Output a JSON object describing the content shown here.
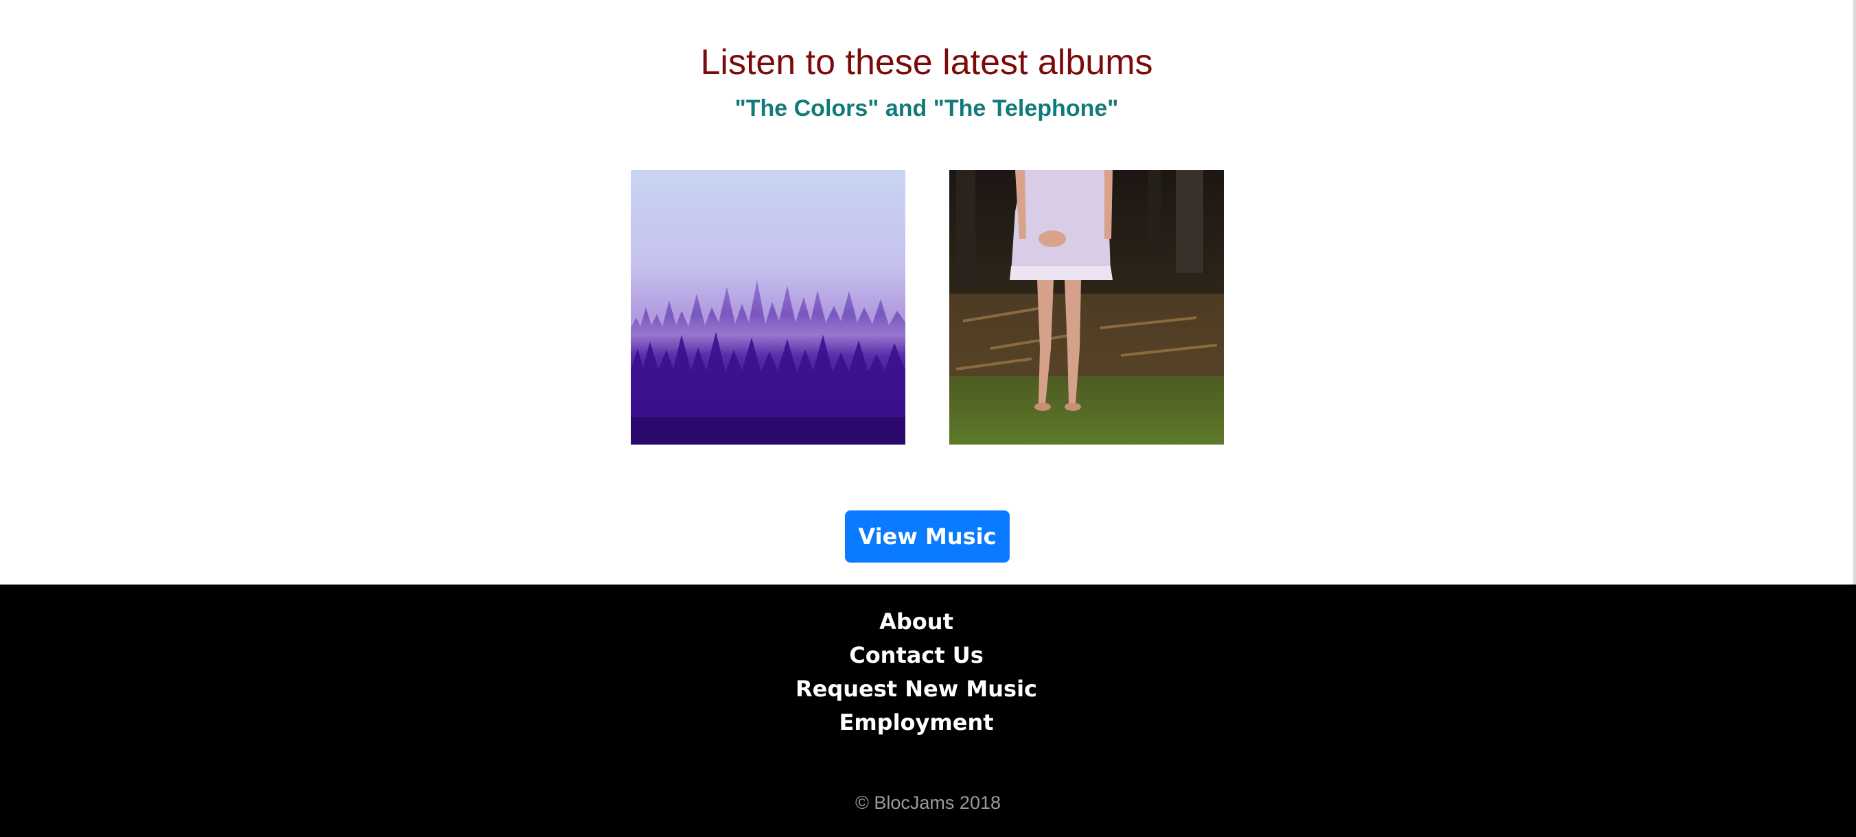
{
  "hero": {
    "title": "Listen to these latest albums",
    "subtitle": "\"The Colors\" and \"The Telephone\""
  },
  "albums": [
    {
      "icon": "forest-fog-album-cover"
    },
    {
      "icon": "girl-in-dress-album-cover"
    }
  ],
  "cta": {
    "label": "View Music",
    "color": "#0a7bff"
  },
  "footer": {
    "links": [
      "About",
      "Contact Us",
      "Request New Music",
      "Employment"
    ],
    "copyright": "© BlocJams 2018"
  },
  "colors": {
    "title": "#7b0a0a",
    "subtitle": "#127a78",
    "footer_bg": "#000000"
  }
}
